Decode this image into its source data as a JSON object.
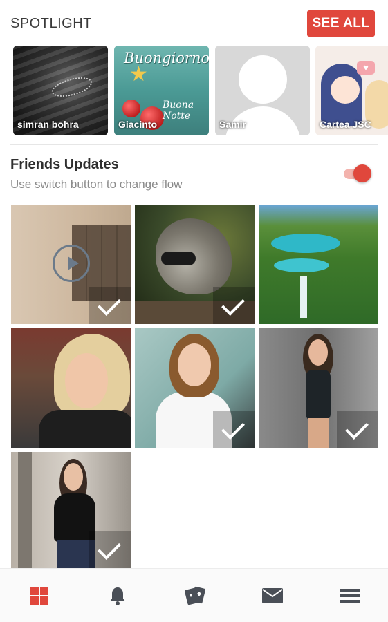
{
  "spotlight": {
    "title": "SPOTLIGHT",
    "see_all_label": "SEE ALL",
    "cards": [
      {
        "name": "simran bohra"
      },
      {
        "name": "Giacinto",
        "greeting": "Buongiorno",
        "subtext": "Buona Notte"
      },
      {
        "name": "Samir"
      },
      {
        "name": "Cartea JSC"
      }
    ]
  },
  "friends_updates": {
    "title": "Friends Updates",
    "subtitle": "Use switch button to change flow",
    "switch_on": true
  },
  "grid": {
    "tiles": [
      {
        "kind": "video",
        "checked": true
      },
      {
        "kind": "photo",
        "checked": true
      },
      {
        "kind": "photo",
        "checked": false
      },
      {
        "kind": "photo",
        "checked": false
      },
      {
        "kind": "photo",
        "checked": true
      },
      {
        "kind": "photo",
        "checked": true
      },
      {
        "kind": "photo",
        "checked": true
      }
    ]
  },
  "bottom_nav": {
    "items": [
      {
        "icon": "grid-icon",
        "active": true
      },
      {
        "icon": "bell-icon",
        "active": false
      },
      {
        "icon": "cards-icon",
        "active": false
      },
      {
        "icon": "envelope-icon",
        "active": false
      },
      {
        "icon": "hamburger-menu-icon",
        "active": false
      }
    ]
  },
  "colors": {
    "accent": "#e0473c",
    "icon_gray": "#4a4f57",
    "switch_track": "#f3b3ad"
  }
}
